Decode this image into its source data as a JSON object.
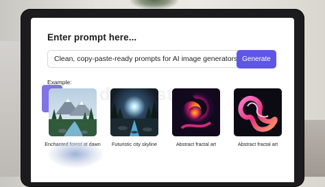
{
  "prompt_panel": {
    "title": "Enter prompt here...",
    "input_value": "Clean, copy-paste-ready prompts for AI image generators",
    "generate_label": "Generate"
  },
  "examples": {
    "label": "Example:",
    "items": [
      {
        "caption": "Enchanted forest at dawn"
      },
      {
        "caption": "Futuristic city skyline"
      },
      {
        "caption": "Abstract fractal art"
      },
      {
        "caption": "Abstract fractal art"
      }
    ]
  },
  "watermark_text": "dreamstime",
  "colors": {
    "accent": "#5f55e6",
    "monitor_bezel": "#1c1c1e",
    "screen_bg": "#ffffff"
  }
}
